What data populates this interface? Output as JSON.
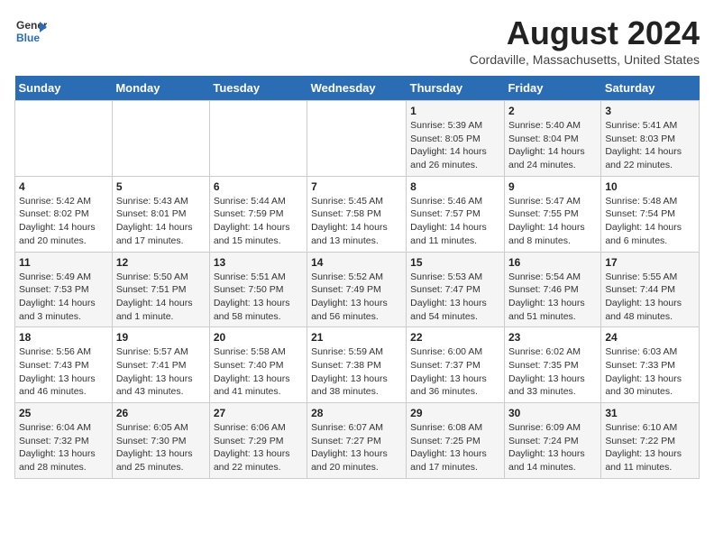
{
  "logo": {
    "line1": "General",
    "line2": "Blue"
  },
  "title": "August 2024",
  "subtitle": "Cordaville, Massachusetts, United States",
  "weekdays": [
    "Sunday",
    "Monday",
    "Tuesday",
    "Wednesday",
    "Thursday",
    "Friday",
    "Saturday"
  ],
  "weeks": [
    [
      {
        "day": "",
        "info": ""
      },
      {
        "day": "",
        "info": ""
      },
      {
        "day": "",
        "info": ""
      },
      {
        "day": "",
        "info": ""
      },
      {
        "day": "1",
        "info": "Sunrise: 5:39 AM\nSunset: 8:05 PM\nDaylight: 14 hours and 26 minutes."
      },
      {
        "day": "2",
        "info": "Sunrise: 5:40 AM\nSunset: 8:04 PM\nDaylight: 14 hours and 24 minutes."
      },
      {
        "day": "3",
        "info": "Sunrise: 5:41 AM\nSunset: 8:03 PM\nDaylight: 14 hours and 22 minutes."
      }
    ],
    [
      {
        "day": "4",
        "info": "Sunrise: 5:42 AM\nSunset: 8:02 PM\nDaylight: 14 hours and 20 minutes."
      },
      {
        "day": "5",
        "info": "Sunrise: 5:43 AM\nSunset: 8:01 PM\nDaylight: 14 hours and 17 minutes."
      },
      {
        "day": "6",
        "info": "Sunrise: 5:44 AM\nSunset: 7:59 PM\nDaylight: 14 hours and 15 minutes."
      },
      {
        "day": "7",
        "info": "Sunrise: 5:45 AM\nSunset: 7:58 PM\nDaylight: 14 hours and 13 minutes."
      },
      {
        "day": "8",
        "info": "Sunrise: 5:46 AM\nSunset: 7:57 PM\nDaylight: 14 hours and 11 minutes."
      },
      {
        "day": "9",
        "info": "Sunrise: 5:47 AM\nSunset: 7:55 PM\nDaylight: 14 hours and 8 minutes."
      },
      {
        "day": "10",
        "info": "Sunrise: 5:48 AM\nSunset: 7:54 PM\nDaylight: 14 hours and 6 minutes."
      }
    ],
    [
      {
        "day": "11",
        "info": "Sunrise: 5:49 AM\nSunset: 7:53 PM\nDaylight: 14 hours and 3 minutes."
      },
      {
        "day": "12",
        "info": "Sunrise: 5:50 AM\nSunset: 7:51 PM\nDaylight: 14 hours and 1 minute."
      },
      {
        "day": "13",
        "info": "Sunrise: 5:51 AM\nSunset: 7:50 PM\nDaylight: 13 hours and 58 minutes."
      },
      {
        "day": "14",
        "info": "Sunrise: 5:52 AM\nSunset: 7:49 PM\nDaylight: 13 hours and 56 minutes."
      },
      {
        "day": "15",
        "info": "Sunrise: 5:53 AM\nSunset: 7:47 PM\nDaylight: 13 hours and 54 minutes."
      },
      {
        "day": "16",
        "info": "Sunrise: 5:54 AM\nSunset: 7:46 PM\nDaylight: 13 hours and 51 minutes."
      },
      {
        "day": "17",
        "info": "Sunrise: 5:55 AM\nSunset: 7:44 PM\nDaylight: 13 hours and 48 minutes."
      }
    ],
    [
      {
        "day": "18",
        "info": "Sunrise: 5:56 AM\nSunset: 7:43 PM\nDaylight: 13 hours and 46 minutes."
      },
      {
        "day": "19",
        "info": "Sunrise: 5:57 AM\nSunset: 7:41 PM\nDaylight: 13 hours and 43 minutes."
      },
      {
        "day": "20",
        "info": "Sunrise: 5:58 AM\nSunset: 7:40 PM\nDaylight: 13 hours and 41 minutes."
      },
      {
        "day": "21",
        "info": "Sunrise: 5:59 AM\nSunset: 7:38 PM\nDaylight: 13 hours and 38 minutes."
      },
      {
        "day": "22",
        "info": "Sunrise: 6:00 AM\nSunset: 7:37 PM\nDaylight: 13 hours and 36 minutes."
      },
      {
        "day": "23",
        "info": "Sunrise: 6:02 AM\nSunset: 7:35 PM\nDaylight: 13 hours and 33 minutes."
      },
      {
        "day": "24",
        "info": "Sunrise: 6:03 AM\nSunset: 7:33 PM\nDaylight: 13 hours and 30 minutes."
      }
    ],
    [
      {
        "day": "25",
        "info": "Sunrise: 6:04 AM\nSunset: 7:32 PM\nDaylight: 13 hours and 28 minutes."
      },
      {
        "day": "26",
        "info": "Sunrise: 6:05 AM\nSunset: 7:30 PM\nDaylight: 13 hours and 25 minutes."
      },
      {
        "day": "27",
        "info": "Sunrise: 6:06 AM\nSunset: 7:29 PM\nDaylight: 13 hours and 22 minutes."
      },
      {
        "day": "28",
        "info": "Sunrise: 6:07 AM\nSunset: 7:27 PM\nDaylight: 13 hours and 20 minutes."
      },
      {
        "day": "29",
        "info": "Sunrise: 6:08 AM\nSunset: 7:25 PM\nDaylight: 13 hours and 17 minutes."
      },
      {
        "day": "30",
        "info": "Sunrise: 6:09 AM\nSunset: 7:24 PM\nDaylight: 13 hours and 14 minutes."
      },
      {
        "day": "31",
        "info": "Sunrise: 6:10 AM\nSunset: 7:22 PM\nDaylight: 13 hours and 11 minutes."
      }
    ]
  ]
}
